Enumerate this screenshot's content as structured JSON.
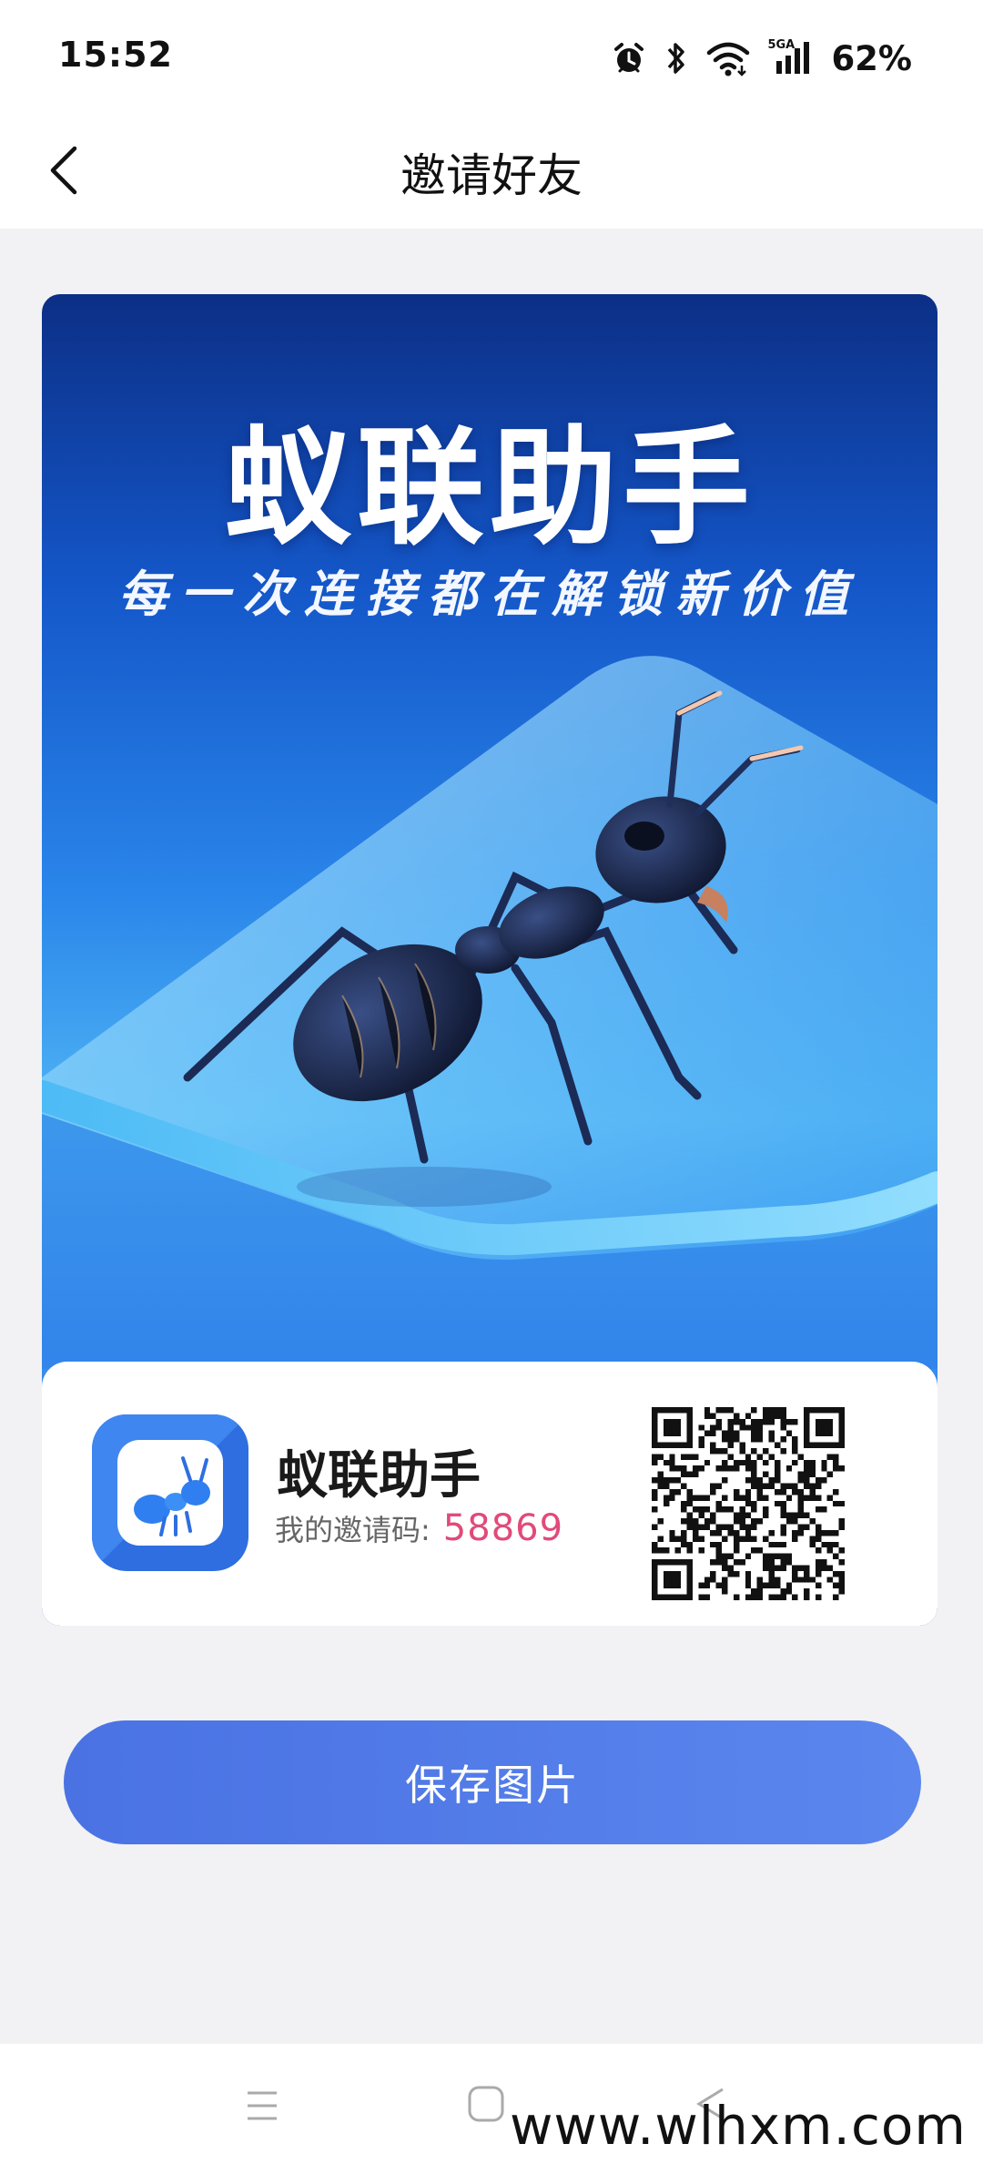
{
  "status_bar": {
    "time": "15:52",
    "network_label": "5GA",
    "battery": "62%"
  },
  "header": {
    "title": "邀请好友",
    "back_icon": "chevron-left-icon"
  },
  "poster": {
    "title": "蚁联助手",
    "slogan": "每一次连接都在解锁新价值",
    "card": {
      "app_name": "蚁联助手",
      "invite_label": "我的邀请码:",
      "invite_code": "58869"
    }
  },
  "actions": {
    "save_label": "保存图片"
  },
  "nav": {
    "recent_icon": "recent-apps-icon",
    "home_icon": "home-icon",
    "back_icon": "back-icon"
  },
  "watermark": "www.wlhxm.com",
  "colors": {
    "accent": "#4f7ae8",
    "invite_code": "#e14a7a",
    "poster_top": "#0c2f86",
    "poster_mid": "#4fb4f4"
  }
}
